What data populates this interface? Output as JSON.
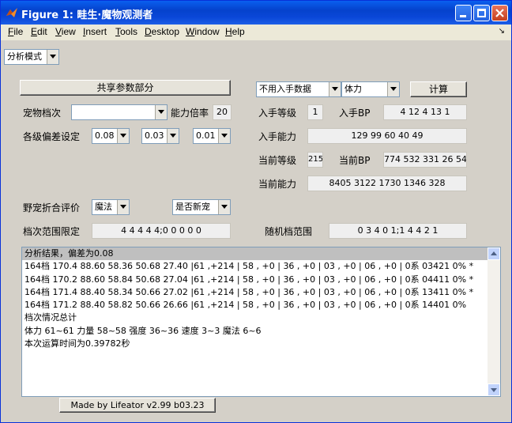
{
  "window": {
    "title": "Figure 1: 畦生·魔物观测者"
  },
  "menu": [
    {
      "u": "F",
      "rest": "ile"
    },
    {
      "u": "E",
      "rest": "dit"
    },
    {
      "u": "V",
      "rest": "iew"
    },
    {
      "u": "I",
      "rest": "nsert"
    },
    {
      "u": "T",
      "rest": "ools"
    },
    {
      "u": "D",
      "rest": "esktop"
    },
    {
      "u": "W",
      "rest": "indow"
    },
    {
      "u": "H",
      "rest": "elp"
    }
  ],
  "mode_select": "分析模式",
  "shared_params_button": "共享参数部分",
  "pet_grade": {
    "label": "宠物档次",
    "value": ""
  },
  "ability_ratio": {
    "label": "能力倍率",
    "value": "20"
  },
  "deviation": {
    "label": "各级偏差设定",
    "v1": "0.08",
    "v2": "0.03",
    "v3": "0.01"
  },
  "input_mode": "不用入手数据",
  "stat": "体力",
  "calc_button": "计算",
  "obtain_level": {
    "label": "入手等级",
    "value": "1"
  },
  "obtain_bp": {
    "label": "入手BP",
    "value": "4 12 4 13 1"
  },
  "obtain_ability": {
    "label": "入手能力",
    "value": "129 99 60 40 49"
  },
  "current_level": {
    "label": "当前等级",
    "value": "215"
  },
  "current_bp": {
    "label": "当前BP",
    "value": "774 532 331 26 54"
  },
  "current_ability": {
    "label": "当前能力",
    "value": "8405 3122 1730 1346 328"
  },
  "wild_eval": {
    "label": "野宠折合评价",
    "value": "魔法"
  },
  "is_new": "是否新宠",
  "grade_range": {
    "label": "档次范围限定",
    "value": "4 4 4 4 4;0 0 0 0 0"
  },
  "random_range": {
    "label": "随机档范围",
    "value": "0 3 4 0 1;1 4 4 2 1"
  },
  "results": [
    "分析结果，偏差为0.08",
    "164档 170.4 88.60 58.36 50.68 27.40 |61 ,+214 | 58 , +0 | 36 , +0 | 03 , +0 | 06 , +0 | 0系 03421   0% *",
    "164档 170.2 88.60 58.84 50.68 27.04 |61 ,+214 | 58 , +0 | 36 , +0 | 03 , +0 | 06 , +0 | 0系 04411   0% *",
    "164档 171.4 88.40 58.34 50.66 27.02 |61 ,+214 | 58 , +0 | 36 , +0 | 03 , +0 | 06 , +0 | 0系 13411   0% *",
    "164档 171.2 88.40 58.82 50.66 26.66 |61 ,+214 | 58 , +0 | 36 , +0 | 03 , +0 | 06 , +0 | 0系 14401   0%",
    "档次情况总计",
    "体力 61~61 力量 58~58 强度 36~36 速度 3~3 魔法 6~6",
    "本次运算时间为0.39782秒"
  ],
  "footer_button": "Made by Lifeator    v2.99 b03.23",
  "colors": {
    "titlebar": "#0A5FEF",
    "panel": "#D4D0C8",
    "selected_line": "#BFBFBF"
  }
}
